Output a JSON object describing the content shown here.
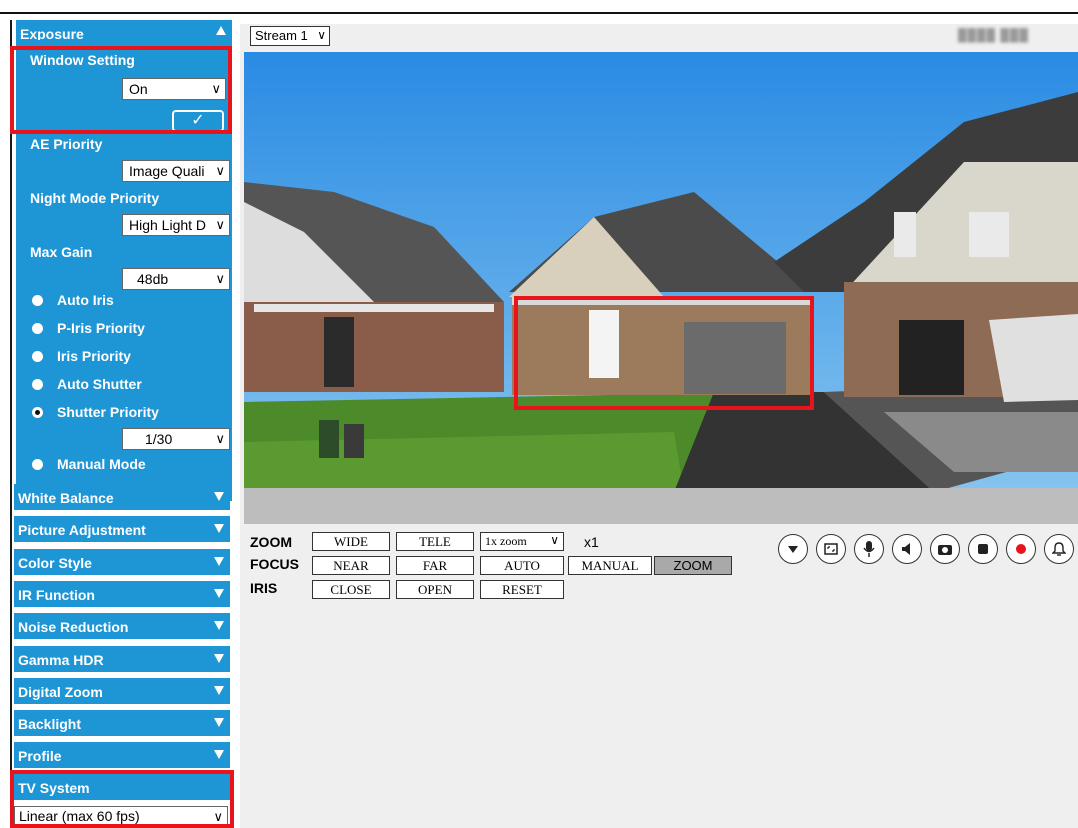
{
  "sidebar": {
    "exposure": {
      "title": "Exposure",
      "window_setting": {
        "label": "Window Setting",
        "value": "On",
        "apply_label": "✓"
      },
      "ae_priority": {
        "label": "AE Priority",
        "value": "Image Quali"
      },
      "night_mode_priority": {
        "label": "Night Mode Priority",
        "value": "High Light D"
      },
      "max_gain": {
        "label": "Max Gain",
        "value": "48db"
      },
      "modes": [
        {
          "label": "Auto Iris",
          "selected": false
        },
        {
          "label": "P-Iris Priority",
          "selected": false
        },
        {
          "label": "Iris Priority",
          "selected": false
        },
        {
          "label": "Auto Shutter",
          "selected": false
        },
        {
          "label": "Shutter Priority",
          "selected": true
        },
        {
          "label": "Manual Mode",
          "selected": false
        }
      ],
      "shutter_value": "1/30"
    },
    "sections": [
      "White Balance",
      "Picture Adjustment",
      "Color Style",
      "IR Function",
      "Noise Reduction",
      "Gamma HDR",
      "Digital Zoom",
      "Backlight",
      "Profile"
    ],
    "tv_system": {
      "title": "TV System",
      "value": "Linear (max 60 fps)"
    }
  },
  "main": {
    "stream_select": "Stream 1",
    "controls": {
      "zoom": {
        "label": "ZOOM",
        "wide": "WIDE",
        "tele": "TELE",
        "zoom_select": "1x zoom",
        "zoom_value": "x1"
      },
      "focus": {
        "label": "FOCUS",
        "near": "NEAR",
        "far": "FAR",
        "auto": "AUTO",
        "manual": "MANUAL",
        "zoom": "ZOOM"
      },
      "iris": {
        "label": "IRIS",
        "close": "CLOSE",
        "open": "OPEN",
        "reset": "RESET"
      }
    },
    "icons": [
      "dropdown-icon",
      "fullscreen-icon",
      "microphone-icon",
      "speaker-icon",
      "snapshot-icon",
      "stop-icon",
      "record-icon",
      "alarm-icon"
    ]
  },
  "colors": {
    "panel_blue": "#1e96d6",
    "highlight_red": "#e8141b",
    "record_red": "#e8141b"
  }
}
